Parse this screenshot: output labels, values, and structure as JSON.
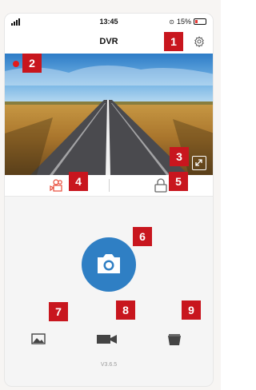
{
  "status_bar": {
    "time": "13:45",
    "battery_text": "15%"
  },
  "navbar": {
    "title": "DVR",
    "settings_icon": "gear-icon"
  },
  "preview": {
    "recording_indicator": "red-dot",
    "expand_icon": "expand-icon"
  },
  "mode_bar": {
    "left_icon": "video-camera-icon",
    "right_icon": "lock-icon"
  },
  "controls": {
    "shutter_icon": "camera-icon",
    "tools": [
      "gallery-icon",
      "video-record-icon",
      "trash-icon"
    ]
  },
  "version": "V3.6.5",
  "markers": [
    "1",
    "2",
    "3",
    "4",
    "5",
    "6",
    "7",
    "8",
    "9"
  ],
  "colors": {
    "accent_blue": "#2f7fc4",
    "record_red": "#e21b1b",
    "marker_red": "#c8161e",
    "mode_icon_red": "#e84b3a"
  }
}
